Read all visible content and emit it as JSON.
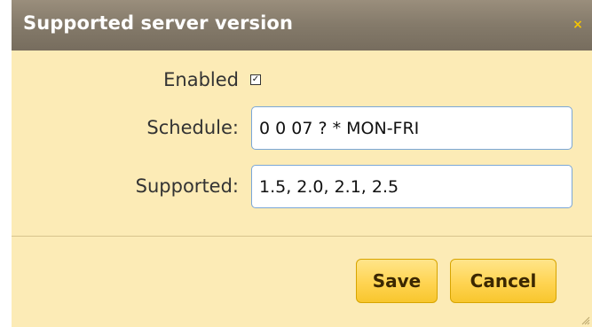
{
  "dialog": {
    "title": "Supported server version",
    "close_glyph": "×",
    "enabled_label": "Enabled",
    "enabled_checked": true,
    "checkbox_glyph": "☑",
    "schedule_label": "Schedule:",
    "schedule_value": "0 0 07 ? * MON-FRI",
    "supported_label": "Supported:",
    "supported_value": "1.5, 2.0, 2.1, 2.5",
    "save_label": "Save",
    "cancel_label": "Cancel"
  },
  "colors": {
    "background": "#fcebb6",
    "titlebar": "#847a6a",
    "close_icon": "#f5c400",
    "button_fill": "#ffd452",
    "input_border": "#7aa7d8"
  }
}
